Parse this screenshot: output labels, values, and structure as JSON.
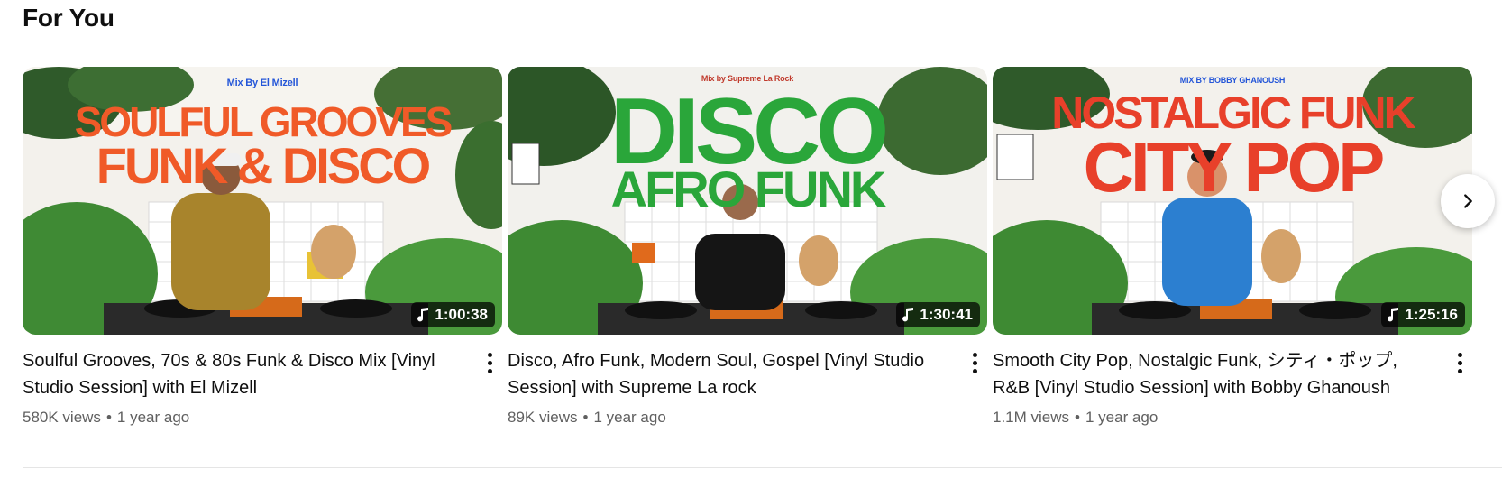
{
  "shelf": {
    "title": "For You",
    "next_icon": "chevron-right-icon",
    "videos": [
      {
        "mix_by": "Mix By El Mizell",
        "headline_line1": "SOULFUL GROOVES",
        "headline_line2": "FUNK & DISCO",
        "headline_color": "#f05a28",
        "duration": "1:00:38",
        "title": "Soulful Grooves, 70s & 80s Funk & Disco Mix [Vinyl Studio Session] with El Mizell",
        "views": "580K views",
        "age": "1 year ago"
      },
      {
        "mix_by": "Mix by Supreme La Rock",
        "headline_line1": "DISCO",
        "headline_line2": "AFRO FUNK",
        "headline_color": "#2aa63a",
        "duration": "1:30:41",
        "title": "Disco, Afro Funk, Modern Soul, Gospel [Vinyl Studio Session] with Supreme La rock",
        "views": "89K views",
        "age": "1 year ago"
      },
      {
        "mix_by": "MIX BY BOBBY GHANOUSH",
        "headline_line1": "NOSTALGIC FUNK",
        "headline_line2": "CITY POP",
        "headline_color": "#e8402a",
        "duration": "1:25:16",
        "title": "Smooth City Pop, Nostalgic Funk, シティ・ポップ, R&B [Vinyl Studio Session] with Bobby Ghanoush",
        "views": "1.1M views",
        "age": "1 year ago"
      }
    ]
  }
}
